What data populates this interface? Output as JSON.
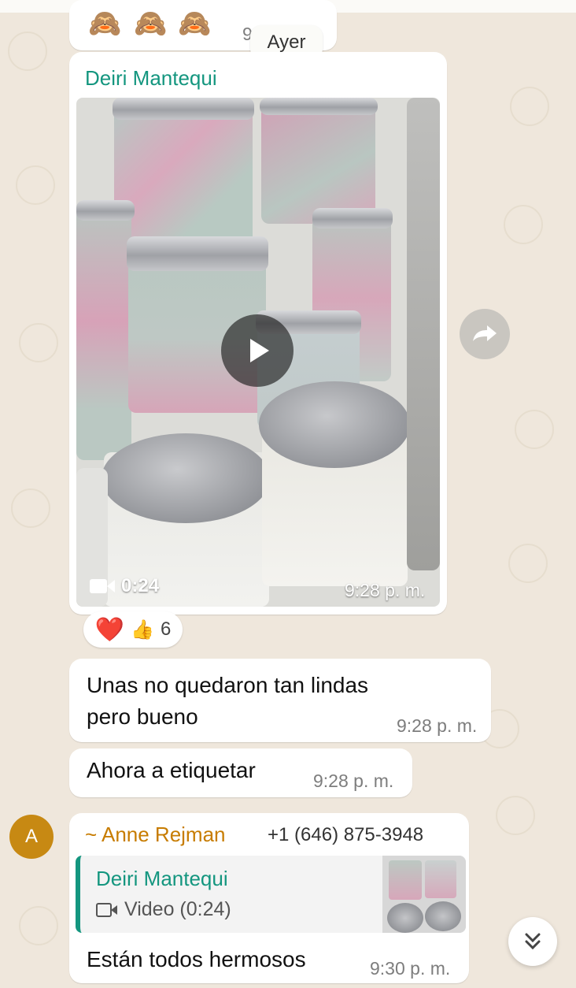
{
  "date_chip": "Ayer",
  "first_message": {
    "emoji": [
      "🙈",
      "🙈",
      "🙈"
    ],
    "time": "9"
  },
  "video_message": {
    "sender": "Deiri Mantequi",
    "duration": "0:24",
    "time": "9:28 p. m.",
    "reactions": {
      "emoji": [
        "❤️",
        "👍"
      ],
      "count": "6"
    }
  },
  "messages": [
    {
      "lines": [
        "Unas no quedaron tan lindas",
        "pero bueno"
      ],
      "time": "9:28 p. m."
    },
    {
      "lines": [
        "Ahora a etiquetar"
      ],
      "time": "9:28 p. m."
    }
  ],
  "reply_message": {
    "avatar_letter": "A",
    "sender": "~ Anne Rejman",
    "phone": "+1 (646) 875-3948",
    "quote": {
      "author": "Deiri Mantequi",
      "label": "Video (0:24)"
    },
    "text": "Están todos hermosos",
    "time": "9:30 p. m."
  },
  "colors": {
    "teal": "#14967f",
    "orange": "#c77c00",
    "background": "#efe7dc"
  },
  "icons": [
    "play-icon",
    "video-camera-icon",
    "forward-icon",
    "double-chevron-down-icon"
  ]
}
